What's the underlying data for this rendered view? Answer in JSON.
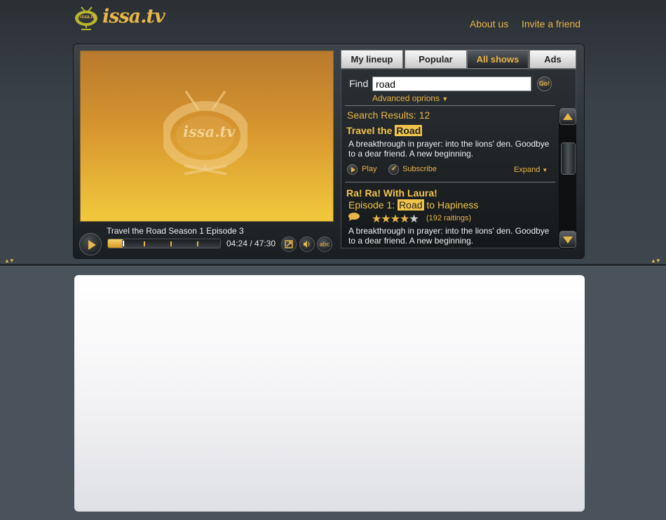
{
  "brand": {
    "name": "issa.tv",
    "badge": "issa.tv"
  },
  "nav": {
    "about": "About us",
    "invite": "Invite a friend"
  },
  "player": {
    "title": "Travel the Road Season 1 Episode 3",
    "time": "04:24 / 47:30",
    "progress_fraction": 0.14,
    "watermark": "issa.tv",
    "buttons": {
      "caption": "abc"
    }
  },
  "tabs": [
    {
      "label": "My lineup",
      "active": false
    },
    {
      "label": "Popular",
      "active": false
    },
    {
      "label": "All shows",
      "active": true
    },
    {
      "label": "Ads",
      "active": false
    }
  ],
  "search": {
    "label": "Find",
    "value": "road",
    "go": "Go!",
    "advanced": "Advanced oprions",
    "results_label": "Search Results: 12"
  },
  "results": [
    {
      "title_pre": "Travel the ",
      "title_hl": "Road",
      "desc": "A breakthrough in prayer: into the lions' den. Goodbye to a dear friend. A new beginning.",
      "play": "Play",
      "subscribe": "Subscribe",
      "expand": "Expand"
    },
    {
      "show": "Ra! Ra! With Laura!",
      "ep_pre": "Episode 1: ",
      "ep_hl": "Road",
      "ep_post": " to Hapiness",
      "rating": 4,
      "rating_max": 5,
      "ratings_text": "(192 raitings)",
      "desc": "A breakthrough in prayer: into the lions' den. Goodbye to a dear friend. A new beginning."
    }
  ],
  "colors": {
    "accent": "#e8b548",
    "highlight": "#f1c44a",
    "video_top": "#b87a2e",
    "video_bottom": "#f1c93c"
  }
}
